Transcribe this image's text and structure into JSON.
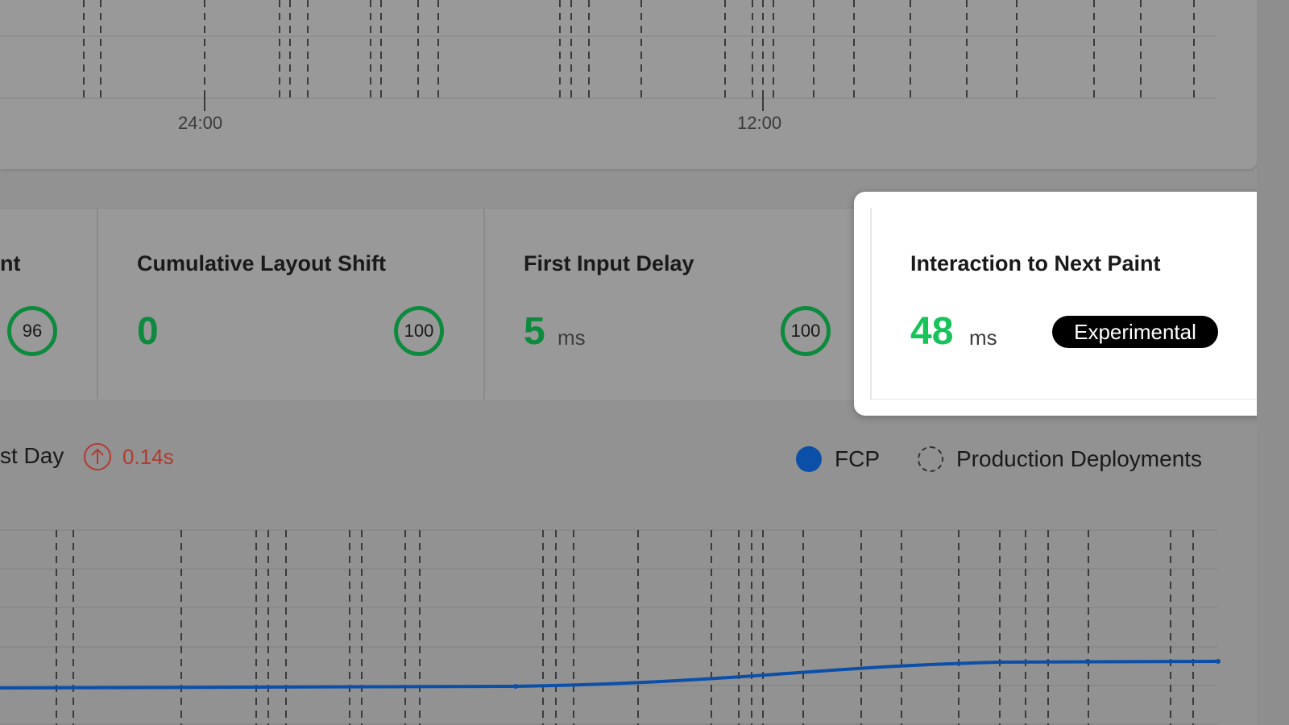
{
  "top_chart": {
    "x_ticks": [
      "24:00",
      "12:00"
    ]
  },
  "metrics": [
    {
      "title": "nt",
      "value": "",
      "unit": "",
      "score": "96"
    },
    {
      "title": "Cumulative Layout Shift",
      "value": "0",
      "unit": "",
      "score": "100"
    },
    {
      "title": "First Input Delay",
      "value": "5",
      "unit": "ms",
      "score": "100"
    },
    {
      "title": "Interaction to Next Paint",
      "value": "48",
      "unit": "ms",
      "badge": "Experimental"
    }
  ],
  "bottom_chart": {
    "period_label": "st Day",
    "delta": "0.14s",
    "legend": [
      {
        "name": "FCP",
        "color": "#0b4fa8"
      },
      {
        "name": "Production Deployments",
        "color": "#333333"
      }
    ]
  },
  "colors": {
    "good": "#0e8a3e",
    "good_bright": "#18c35a",
    "bad": "#b23a30",
    "line": "#0b4fa8"
  }
}
